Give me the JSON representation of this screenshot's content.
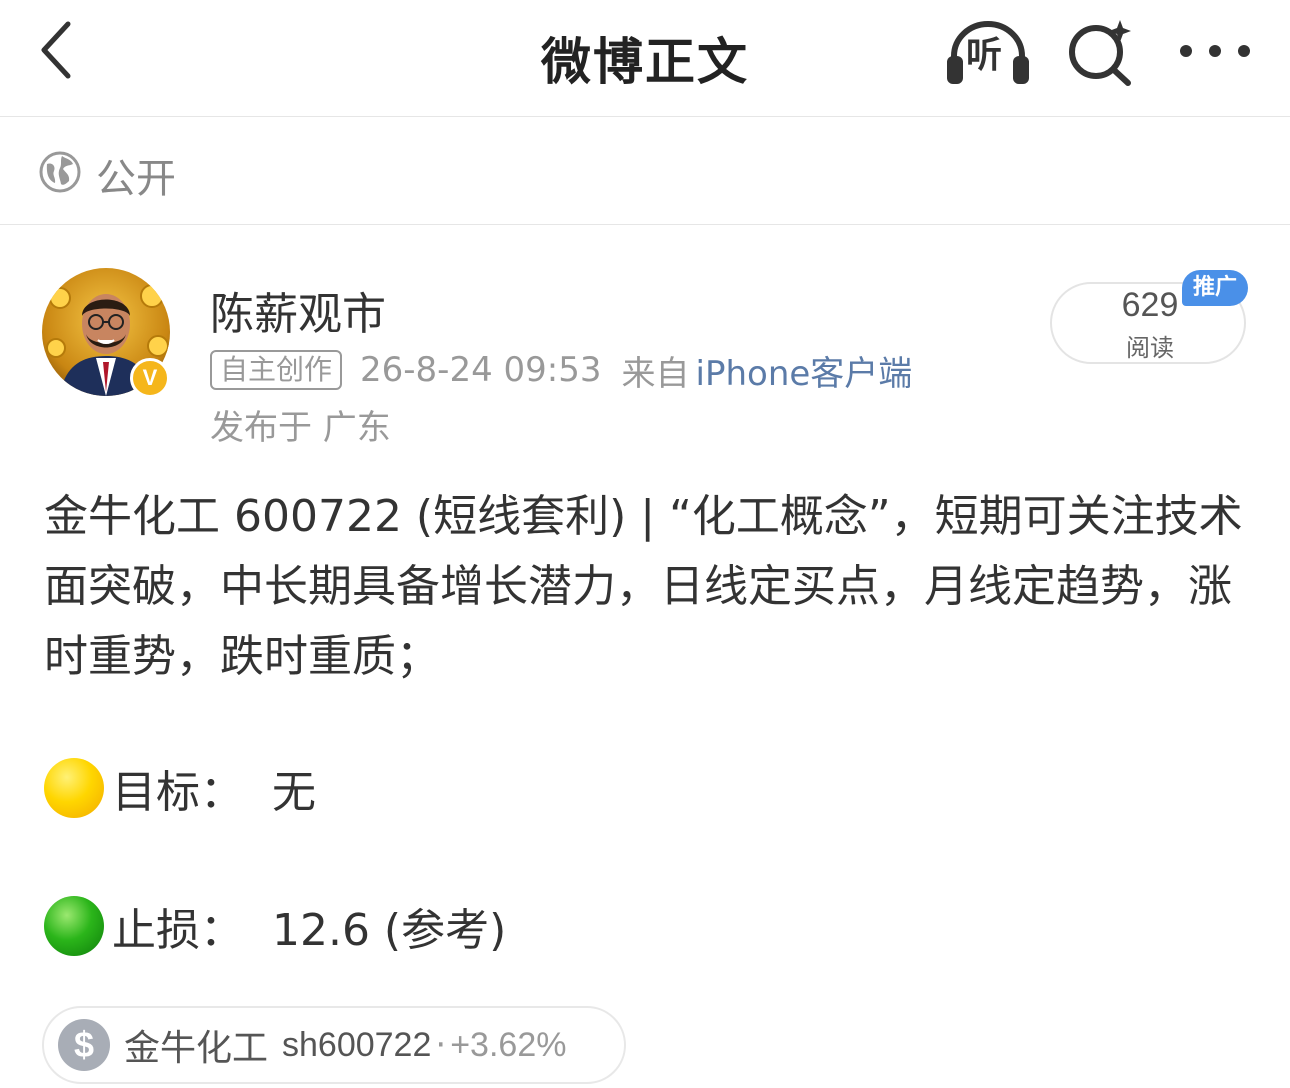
{
  "header": {
    "title": "微博正文",
    "listen_label": "听"
  },
  "privacy": {
    "label": "公开"
  },
  "post": {
    "username": "陈薪观市",
    "tag": "自主创作",
    "time": "26-8-24 09:53",
    "from_label": "来自",
    "client": "iPhone客户端",
    "location": "发布于 广东",
    "reads_count": "629",
    "reads_label": "阅读",
    "promo_badge": "推广",
    "body": "金牛化工 600722 (短线套利) | “化工概念”，短期可关注技术面突破，中长期具备增长潜力，日线定买点，月线定趋势，涨时重势，跌时重质；",
    "target_text": "目标：  无",
    "stop_text": "止损：  12.6 (参考)"
  },
  "stock_chip": {
    "name": "金牛化工",
    "code": "sh600722",
    "separator": "·",
    "change": "+3.62%"
  },
  "colors": {
    "link_blue": "#5b7ba8",
    "promo_blue": "#4a90e8",
    "verified_gold": "#f5b61b"
  },
  "icons": [
    "back-icon",
    "headphones-icon",
    "search-sparkle-icon",
    "more-icon",
    "globe-icon",
    "verified-badge-icon",
    "dollar-icon",
    "yellow-circle-emoji",
    "green-circle-emoji"
  ]
}
